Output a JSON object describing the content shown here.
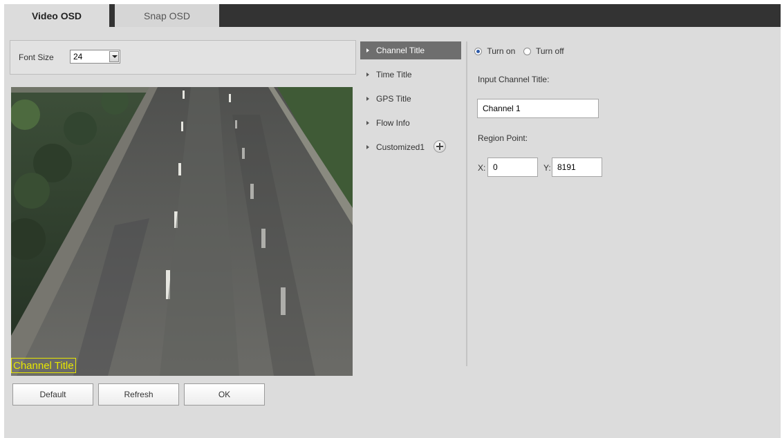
{
  "tabs": [
    {
      "label": "Video OSD",
      "active": true
    },
    {
      "label": "Snap OSD",
      "active": false
    }
  ],
  "font": {
    "label": "Font Size",
    "value": "24"
  },
  "preview": {
    "overlay_text": "Channel Title",
    "overlay_color": "#e8e800"
  },
  "buttons": {
    "default": "Default",
    "refresh": "Refresh",
    "ok": "OK"
  },
  "menu": {
    "items": [
      {
        "label": "Channel Title",
        "active": true
      },
      {
        "label": "Time Title"
      },
      {
        "label": "GPS Title"
      },
      {
        "label": "Flow Info"
      },
      {
        "label": "Customized1",
        "icon": "plus-icon"
      }
    ]
  },
  "settings": {
    "turn_on": "Turn on",
    "turn_off": "Turn off",
    "state": "on",
    "input_label": "Input Channel Title:",
    "channel_title": "Channel 1",
    "region_label": "Region Point:",
    "x_label": "X:",
    "x_value": "0",
    "y_label": "Y:",
    "y_value": "8191"
  },
  "colors": {
    "background": "#dcdcdc",
    "tabbar": "#333333",
    "active_menu": "#6e6e6e"
  }
}
